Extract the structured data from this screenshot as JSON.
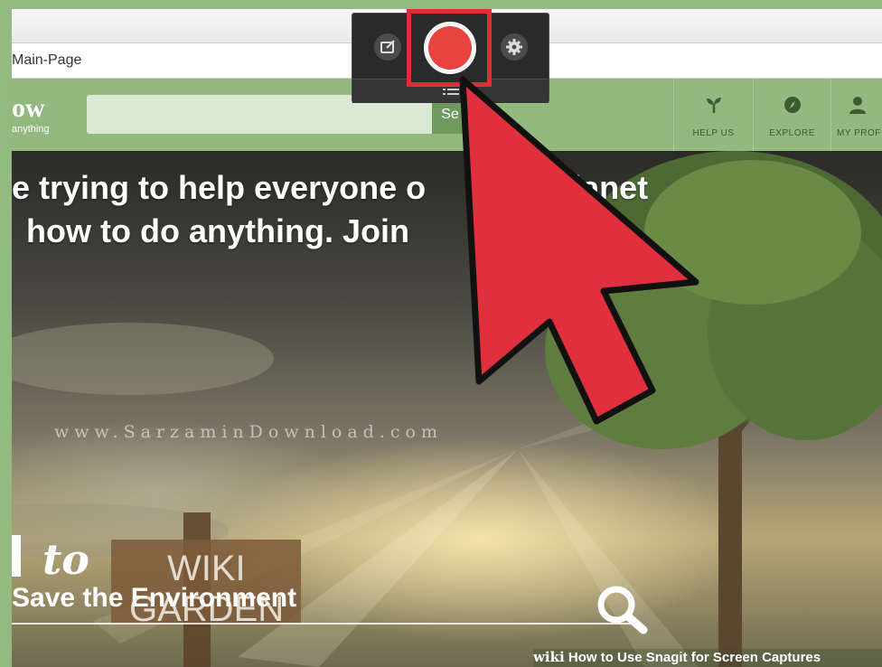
{
  "browser": {
    "address_text": "Main-Page"
  },
  "site": {
    "logo": "ow",
    "tagline": "anything",
    "search_button": "Se",
    "nav": [
      {
        "label": "HELP US",
        "icon": "sprout-icon"
      },
      {
        "label": "EXPLORE",
        "icon": "compass-icon"
      },
      {
        "label": "MY PROF",
        "icon": "person-icon"
      }
    ]
  },
  "hero": {
    "line1": "e trying to help everyone o",
    "line1_end": "planet",
    "line2": "how to do anything. Join",
    "watermark": "www.SarzaminDownload.com",
    "sign_top": "WIKI",
    "sign_bottom": "GARDEN",
    "how_to": "to",
    "subtitle": "Save the Environment"
  },
  "footer": {
    "wiki": "wiki",
    "caption": "How to Use Snagit for Screen Captures"
  },
  "toolbar": {
    "colors": {
      "capture": "#e8433f",
      "highlight": "#de2f39",
      "arrow": "#e0303d"
    }
  }
}
